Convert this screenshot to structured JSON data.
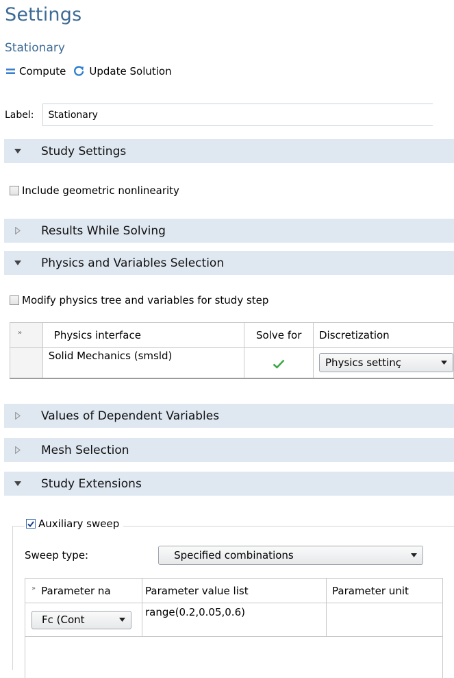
{
  "header": {
    "title": "Settings",
    "subtitle": "Stationary"
  },
  "toolbar": {
    "compute_label": "Compute",
    "update_label": "Update Solution"
  },
  "label_field": {
    "label": "Label:",
    "value": "Stationary"
  },
  "sections": {
    "study_settings": "Study Settings",
    "results_while_solving": "Results While Solving",
    "physics_and_variables": "Physics and Variables Selection",
    "values_dependent": "Values of Dependent Variables",
    "mesh_selection": "Mesh Selection",
    "study_extensions": "Study Extensions"
  },
  "study_settings": {
    "geom_nonlin_label": "Include geometric nonlinearity",
    "geom_nonlin_checked": false
  },
  "physics": {
    "modify_label": "Modify physics tree and variables for study step",
    "modify_checked": false,
    "columns": [
      "Physics interface",
      "Solve for",
      "Discretization"
    ],
    "rows": [
      {
        "interface": "Solid Mechanics (smsld)",
        "solve_for": true,
        "discretization": "Physics settinç"
      }
    ]
  },
  "extensions": {
    "aux_sweep_label": "Auxiliary sweep",
    "aux_sweep_checked": true,
    "sweep_type_label": "Sweep type:",
    "sweep_type_value": "Specified combinations",
    "columns": [
      "Parameter na",
      "Parameter value list",
      "Parameter unit"
    ],
    "rows": [
      {
        "name": "Fc (Cont",
        "values": "range(0.2,0.05,0.6)",
        "unit": ""
      }
    ]
  },
  "colors": {
    "accent": "#3d6b96",
    "section_bg": "#dfe7f1",
    "check_green": "#3aa845"
  }
}
